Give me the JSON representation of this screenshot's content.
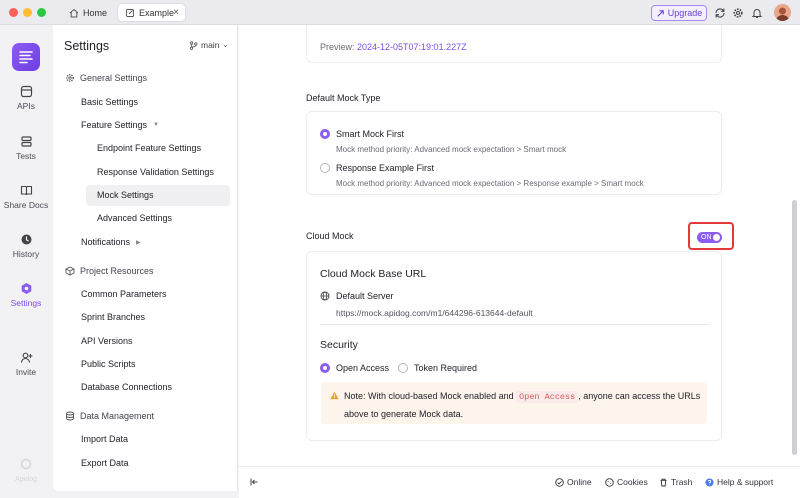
{
  "tabs": [
    {
      "label": "Home"
    },
    {
      "label": "Example"
    }
  ],
  "toolbar": {
    "upgrade_label": "Upgrade"
  },
  "rail": {
    "items": [
      {
        "label": "APIs"
      },
      {
        "label": "Tests"
      },
      {
        "label": "Share Docs"
      },
      {
        "label": "History"
      },
      {
        "label": "Settings"
      },
      {
        "label": "Invite"
      },
      {
        "label": "Apidog"
      }
    ]
  },
  "settings": {
    "title": "Settings",
    "branch": "main",
    "nav": {
      "general": "General Settings",
      "basic": "Basic Settings",
      "feature": "Feature Settings",
      "endpoint_feature": "Endpoint Feature Settings",
      "response_validation": "Response Validation Settings",
      "mock": "Mock Settings",
      "advanced": "Advanced Settings",
      "notifications": "Notifications",
      "project_resources": "Project Resources",
      "common_parameters": "Common Parameters",
      "sprint_branches": "Sprint Branches",
      "api_versions": "API Versions",
      "public_scripts": "Public Scripts",
      "database_connections": "Database Connections",
      "data_management": "Data Management",
      "import_data": "Import Data",
      "export_data": "Export Data"
    }
  },
  "main": {
    "preview_label": "Preview:",
    "preview_value": "2024-12-05T07:19:01.227Z",
    "default_mock_type": "Default Mock Type",
    "smart_mock": "Smart Mock First",
    "smart_mock_desc": "Mock method priority: Advanced mock expectation > Smart mock",
    "response_example": "Response Example First",
    "response_example_desc": "Mock method priority: Advanced mock expectation > Response example > Smart mock",
    "cloud_mock": "Cloud Mock",
    "toggle_label": "ON",
    "base_url_title": "Cloud Mock Base URL",
    "default_server": "Default Server",
    "server_url": "https://mock.apidog.com/m1/644296-613644-default",
    "security_title": "Security",
    "open_access": "Open Access",
    "token_required": "Token Required",
    "note_prefix": "Note: With cloud-based Mock enabled and",
    "note_code": "Open Access",
    "note_suffix": ", anyone can access the URLs",
    "note_line2": "above to generate Mock data."
  },
  "footer": {
    "online": "Online",
    "cookies": "Cookies",
    "trash": "Trash",
    "help": "Help & support"
  },
  "colors": {
    "accent": "#8a5cf0",
    "highlight": "#e03a3a"
  }
}
